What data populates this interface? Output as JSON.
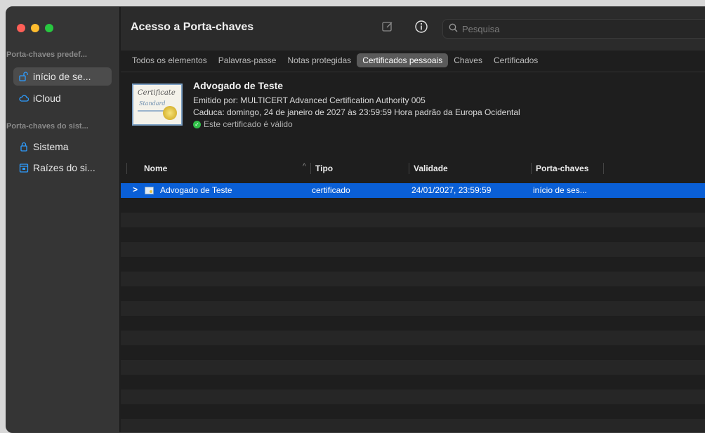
{
  "window": {
    "title": "Acesso a Porta-chaves"
  },
  "sidebar": {
    "default_section": "Porta-chaves predef...",
    "default_items": [
      {
        "label": "início de se...",
        "icon": "lock-open-icon",
        "selected": true
      },
      {
        "label": "iCloud",
        "icon": "cloud-icon",
        "selected": false
      }
    ],
    "system_section": "Porta-chaves do sist...",
    "system_items": [
      {
        "label": "Sistema",
        "icon": "lock-icon"
      },
      {
        "label": "Raízes do si...",
        "icon": "cabinet-icon"
      }
    ]
  },
  "toolbar": {
    "edit_icon": "compose-icon",
    "info_icon": "info-icon",
    "search_placeholder": "Pesquisa"
  },
  "tabs": [
    {
      "label": "Todos os elementos",
      "active": false
    },
    {
      "label": "Palavras-passe",
      "active": false
    },
    {
      "label": "Notas protegidas",
      "active": false
    },
    {
      "label": "Certificados pessoais",
      "active": true
    },
    {
      "label": "Chaves",
      "active": false
    },
    {
      "label": "Certificados",
      "active": false
    }
  ],
  "certificate": {
    "thumb_title": "Certificate",
    "thumb_subtitle": "Standard",
    "name": "Advogado de Teste",
    "issuer": "Emitido por: MULTICERT Advanced Certification Authority 005",
    "expires": "Caduca: domingo, 24 de janeiro de 2027 às 23:59:59 Hora padrão da Europa Ocidental",
    "status": "Este certificado é válido"
  },
  "table": {
    "columns": [
      "Nome",
      "Tipo",
      "Validade",
      "Porta-chaves"
    ],
    "sort_indicator": "^",
    "rows": [
      {
        "name": "Advogado de Teste",
        "type": "certificado",
        "validity": "24/01/2027, 23:59:59",
        "keychain": "início de ses...",
        "disclosure": ">"
      }
    ]
  },
  "colors": {
    "selection": "#0a5fd6",
    "accent": "#2d9cff",
    "valid_green": "#30c048"
  }
}
